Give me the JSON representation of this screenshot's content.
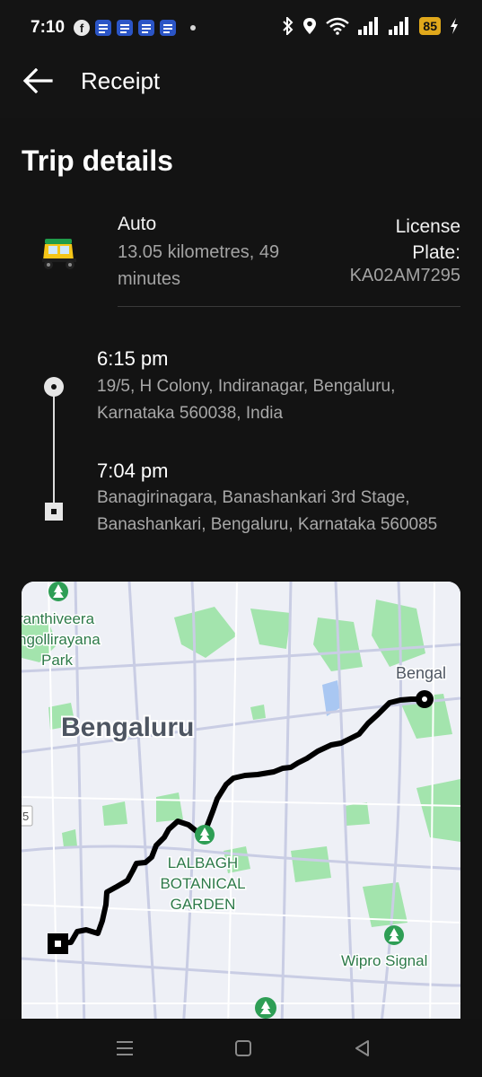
{
  "status_bar": {
    "time": "7:10",
    "battery": "85",
    "icons": [
      "facebook-icon",
      "docs-icon",
      "docs-icon",
      "docs-icon",
      "docs-icon",
      "bluetooth-icon",
      "location-icon",
      "wifi-icon",
      "signal-icon",
      "signal-icon",
      "charging-icon"
    ]
  },
  "header": {
    "title": "Receipt",
    "back_icon": "arrow-left-icon"
  },
  "trip": {
    "section_title": "Trip details",
    "vehicle": "Auto",
    "distance_duration": "13.05 kilometres, 49 minutes",
    "license_label": "License Plate:",
    "license_plate": "KA02AM7295",
    "vehicle_icon": "auto-rickshaw-icon"
  },
  "stops": [
    {
      "time": "6:15 pm",
      "address": "19/5, H Colony, Indiranagar, Bengaluru, Karnataka 560038, India"
    },
    {
      "time": "7:04 pm",
      "address": "Banagirinagara, Banashankari 3rd Stage, Banashankari, Bengaluru, Karnataka 560085"
    }
  ],
  "map": {
    "labels": {
      "park": "ranthiveera\nngollirayana\nPark",
      "city": "Bengaluru",
      "city_edge": "Bengal",
      "road_number": "5",
      "garden": "LALBAGH\nBOTANICAL\nGARDEN",
      "signal": "Wipro Signal"
    },
    "colors": {
      "land": "#eef0f6",
      "green": "#9fe3aa",
      "route": "#000000",
      "water": "#a9c7f2",
      "poi": "#2e9e55"
    }
  },
  "nav_bar": {
    "icons": [
      "menu-icon",
      "home-square-icon",
      "back-triangle-icon"
    ]
  }
}
